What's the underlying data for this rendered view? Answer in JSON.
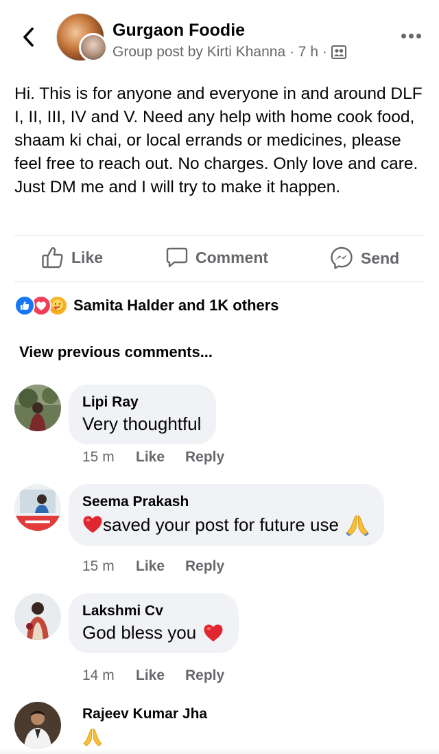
{
  "header": {
    "group_name": "Gurgaon Foodie",
    "meta": "Group post by Kirti Khanna · 7 h ·",
    "icons": {
      "back": "chevron-left-icon",
      "more": "more-horizontal-icon",
      "privacy": "group-members-icon"
    }
  },
  "post": {
    "text": "Hi. This is for anyone and everyone in and around DLF I, II, III, IV and V. Need any help with home cook food, shaam ki chai, or local errands or medicines, please feel free to reach out. No charges. Only love and care. Just DM me and I will try to make it happen."
  },
  "actions": {
    "like": "Like",
    "comment": "Comment",
    "send": "Send"
  },
  "reactions": {
    "summary": "Samita Halder and 1K others",
    "types": [
      "like",
      "love",
      "care"
    ]
  },
  "view_previous": "View previous comments...",
  "comments": [
    {
      "name": "Lipi Ray",
      "text": "Very thoughtful",
      "time": "15 m",
      "like": "Like",
      "reply": "Reply"
    },
    {
      "name": "Seema Prakash",
      "text": "saved your post for future use",
      "time": "15 m",
      "like": "Like",
      "reply": "Reply"
    },
    {
      "name": "Lakshmi Cv",
      "text": "God bless you",
      "time": "14 m",
      "like": "Like",
      "reply": "Reply"
    },
    {
      "name": "Rajeev Kumar Jha",
      "text": ""
    }
  ],
  "colors": {
    "primary_text": "#050505",
    "secondary_text": "#65676b",
    "bubble": "#f0f2f5",
    "like_blue": "#1877f2",
    "love_red": "#f33e58",
    "care_yellow": "#f7b125"
  }
}
